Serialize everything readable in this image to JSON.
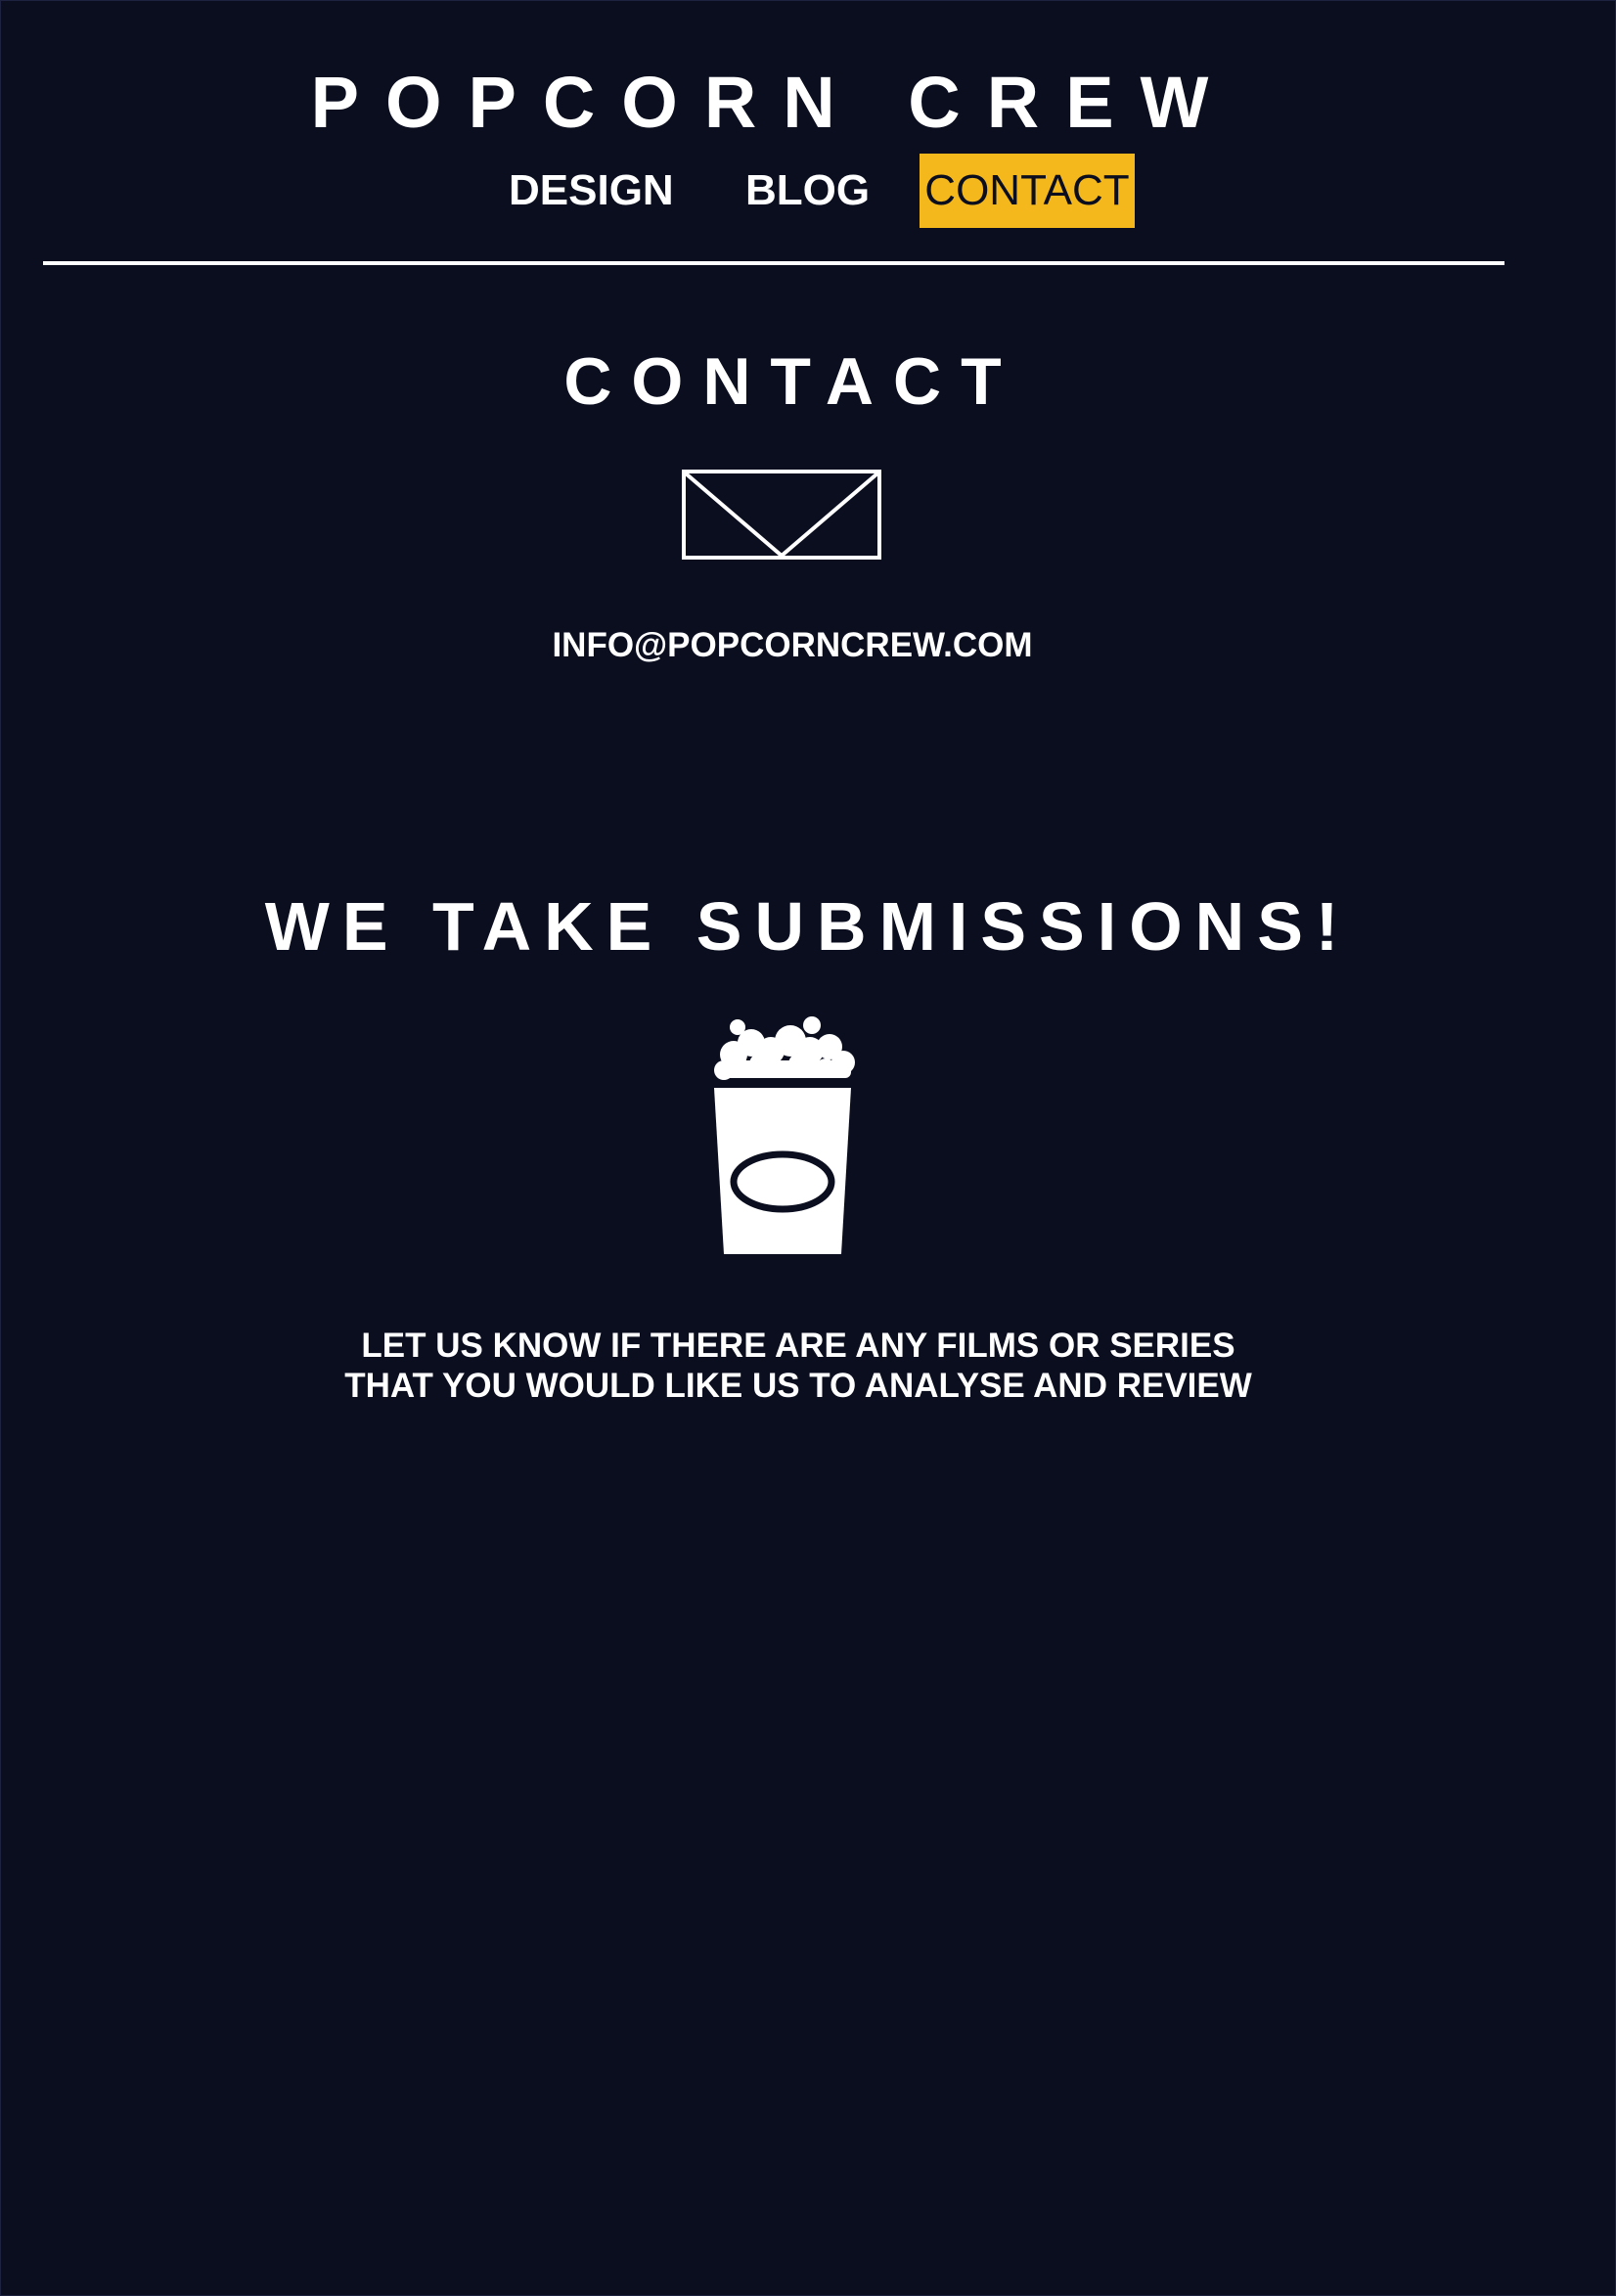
{
  "site": {
    "title": "POPCORN CREW"
  },
  "nav": {
    "items": [
      {
        "label": "DESIGN",
        "active": false
      },
      {
        "label": "BLOG",
        "active": false
      },
      {
        "label": "CONTACT",
        "active": true
      }
    ],
    "active_color": "#f4b81c"
  },
  "contact": {
    "heading": "CONTACT",
    "icon": "envelope-icon",
    "email": "INFO@POPCORNCREW.COM"
  },
  "submissions": {
    "heading": "WE TAKE SUBMISSIONS!",
    "icon": "popcorn-icon",
    "text_lines": [
      "LET US KNOW IF THERE ARE ANY FILMS OR SERIES",
      "THAT YOU WOULD LIKE US TO ANALYSE AND REVIEW"
    ]
  },
  "colors": {
    "background": "#0b0e1f",
    "foreground": "#ffffff",
    "accent": "#f4b81c"
  }
}
